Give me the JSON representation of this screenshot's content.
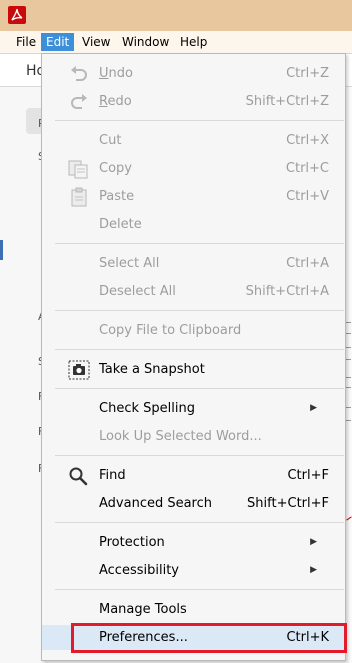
{
  "menubar": {
    "items": [
      "File",
      "Edit",
      "View",
      "Window",
      "Help"
    ],
    "active": "Edit"
  },
  "background": {
    "tab_fragment": "Ho",
    "left_letters": [
      "P",
      "S",
      "A",
      "A",
      "S",
      "F",
      "F",
      "F"
    ]
  },
  "edit_menu": {
    "items": [
      {
        "mnemonic": "U",
        "rest": "ndo",
        "shortcut": "Ctrl+Z",
        "icon": "undo-icon",
        "enabled": false
      },
      {
        "mnemonic": "R",
        "rest": "edo",
        "shortcut": "Shift+Ctrl+Z",
        "icon": "redo-icon",
        "enabled": false
      },
      {
        "label": "Cut",
        "shortcut": "Ctrl+X",
        "enabled": false
      },
      {
        "label": "Copy",
        "shortcut": "Ctrl+C",
        "icon": "copy-icon",
        "enabled": false
      },
      {
        "label": "Paste",
        "shortcut": "Ctrl+V",
        "icon": "paste-icon",
        "enabled": false
      },
      {
        "label": "Delete",
        "shortcut": "",
        "enabled": false
      },
      {
        "label": "Select All",
        "shortcut": "Ctrl+A",
        "enabled": false
      },
      {
        "label": "Deselect All",
        "shortcut": "Shift+Ctrl+A",
        "enabled": false
      },
      {
        "label": "Copy File to Clipboard",
        "shortcut": "",
        "enabled": false
      },
      {
        "label": "Take a Snapshot",
        "shortcut": "",
        "icon": "camera-icon",
        "enabled": true
      },
      {
        "label": "Check Spelling",
        "shortcut": "",
        "submenu": true,
        "enabled": true
      },
      {
        "label": "Look Up Selected Word...",
        "shortcut": "",
        "enabled": false
      },
      {
        "label": "Find",
        "shortcut": "Ctrl+F",
        "icon": "search-icon",
        "enabled": true
      },
      {
        "label": "Advanced Search",
        "shortcut": "Shift+Ctrl+F",
        "enabled": true
      },
      {
        "label": "Protection",
        "shortcut": "",
        "submenu": true,
        "enabled": true
      },
      {
        "label": "Accessibility",
        "shortcut": "",
        "submenu": true,
        "enabled": true
      },
      {
        "label": "Manage Tools",
        "shortcut": "",
        "enabled": true
      },
      {
        "label": "Preferences...",
        "shortcut": "Ctrl+K",
        "enabled": true,
        "highlighted": true
      }
    ]
  },
  "colors": {
    "menubar_active": "#3c8fd8",
    "highlight_outline": "#e21b2a",
    "disabled_text": "#9d9d9d"
  }
}
